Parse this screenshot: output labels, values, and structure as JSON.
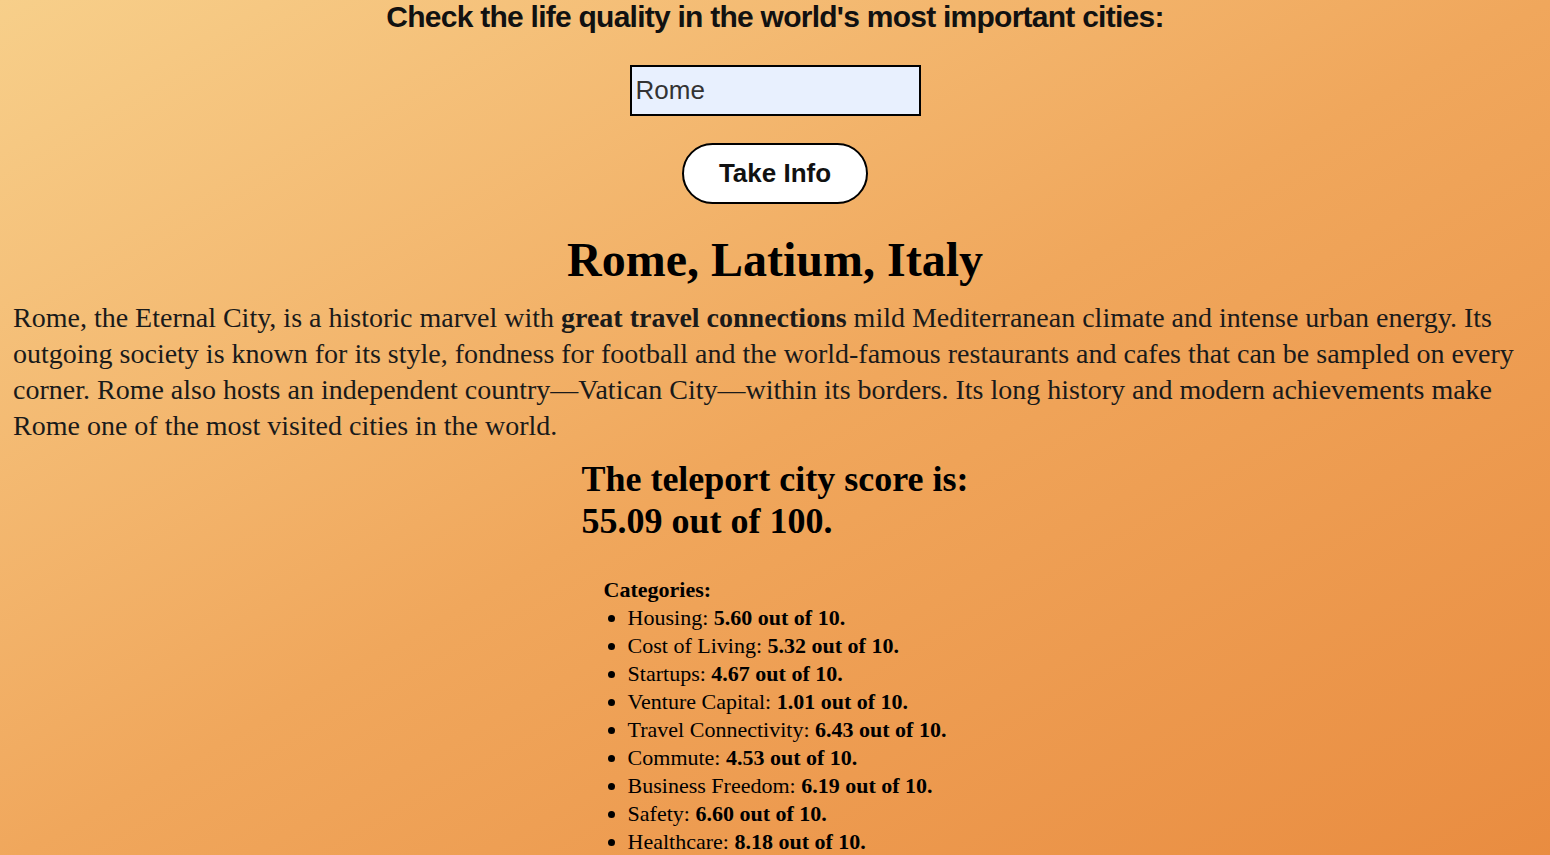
{
  "page": {
    "heading": "Check the life quality in the world's most important cities:"
  },
  "search": {
    "value": "Rome"
  },
  "button": {
    "label": "Take Info"
  },
  "city": {
    "title": "Rome, Latium, Italy",
    "summary": [
      {
        "text": "Rome, the Eternal City, is a historic marvel with ",
        "bold": false
      },
      {
        "text": "great travel connections",
        "bold": true
      },
      {
        "text": " mild Mediterranean climate and intense urban energy. Its outgoing society is known for its style, fondness for football and the world-famous restaurants and cafes that can be sampled on every corner. Rome also hosts an independent country—Vatican City—within its borders. Its long history and modern achievements make Rome one of the most visited cities in the world.",
        "bold": false
      }
    ]
  },
  "score": {
    "label": "The teleport city score is:",
    "value": "55.09 out of 100."
  },
  "categories": {
    "label": "Categories:",
    "items": [
      {
        "name": "Housing:",
        "score": "5.60 out of 10."
      },
      {
        "name": "Cost of Living:",
        "score": "5.32 out of 10."
      },
      {
        "name": "Startups:",
        "score": "4.67 out of 10."
      },
      {
        "name": "Venture Capital:",
        "score": "1.01 out of 10."
      },
      {
        "name": "Travel Connectivity:",
        "score": "6.43 out of 10."
      },
      {
        "name": "Commute:",
        "score": "4.53 out of 10."
      },
      {
        "name": "Business Freedom:",
        "score": "6.19 out of 10."
      },
      {
        "name": "Safety:",
        "score": "6.60 out of 10."
      },
      {
        "name": "Healthcare:",
        "score": "8.18 out of 10."
      }
    ]
  }
}
